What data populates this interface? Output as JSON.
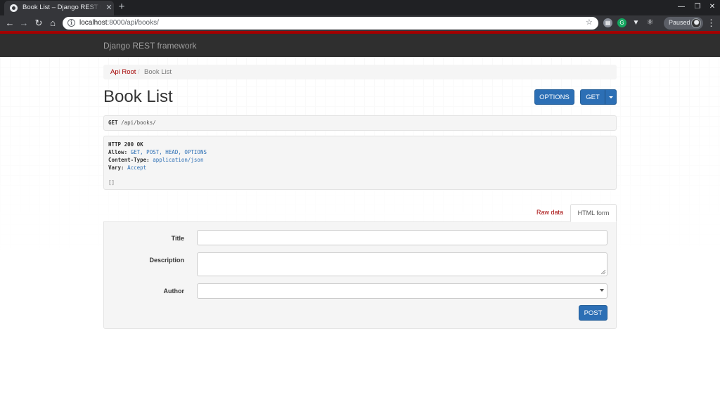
{
  "browser": {
    "tab_title": "Book List – Django REST framework",
    "tab_close": "✕",
    "new_tab": "+",
    "url_host": "localhost",
    "url_path": ":8000/api/books/",
    "profile_status": "Paused"
  },
  "navbar": {
    "brand": "Django REST framework"
  },
  "breadcrumb": {
    "root": "Api Root",
    "separator": "/",
    "current": "Book List"
  },
  "page": {
    "title": "Book List"
  },
  "buttons": {
    "options": "OPTIONS",
    "get": "GET",
    "post": "POST"
  },
  "request": {
    "method": "GET",
    "path": "/api/books/"
  },
  "response": {
    "status": "HTTP 200 OK",
    "headers": [
      {
        "key": "Allow:",
        "value": "GET, POST, HEAD, OPTIONS"
      },
      {
        "key": "Content-Type:",
        "value": "application/json"
      },
      {
        "key": "Vary:",
        "value": "Accept"
      }
    ],
    "body": "[]"
  },
  "form_tabs": {
    "raw": "Raw data",
    "html": "HTML form"
  },
  "form": {
    "title_label": "Title",
    "title_value": "",
    "description_label": "Description",
    "description_value": "",
    "author_label": "Author",
    "author_value": ""
  },
  "icons": [
    "globe-favicon",
    "back-arrow-icon",
    "forward-arrow-icon",
    "reload-icon",
    "home-icon",
    "info-icon",
    "star-icon",
    "kebab-menu-icon"
  ]
}
